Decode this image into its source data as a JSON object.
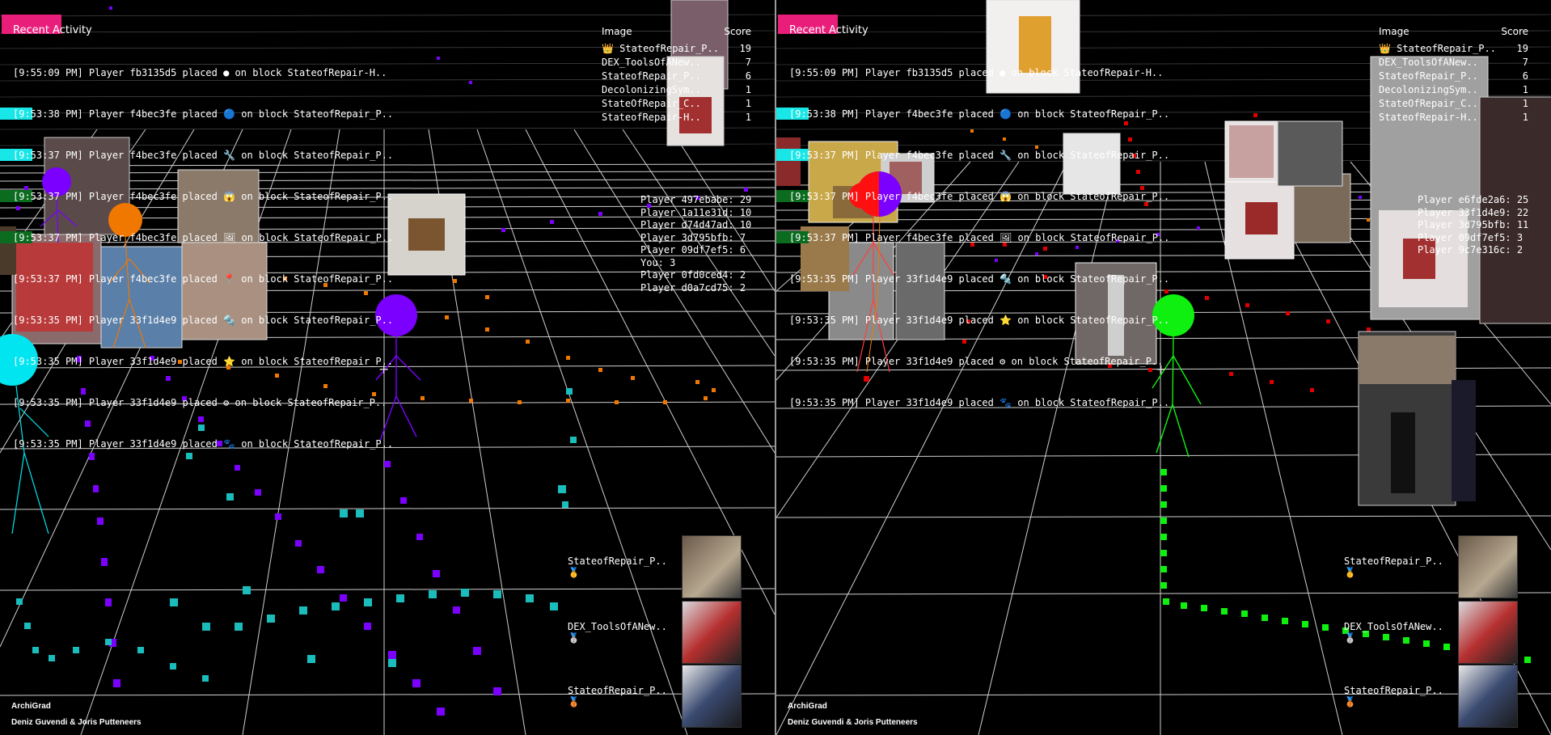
{
  "panes": [
    {
      "id": "left",
      "activity_title": "Recent Activity",
      "log": [
        {
          "text": "[9:55:09 PM] Player fb3135d5 placed ● on block StateofRepair-H..",
          "swatch": ""
        },
        {
          "text": "[9:53:38 PM] Player f4bec3fe placed 🔵 on block StateofRepair_P..",
          "swatch": "#19e6e6"
        },
        {
          "text": "[9:53:37 PM] Player f4bec3fe placed 🔧 on block StateofRepair_P..",
          "swatch": "#19e6e6"
        },
        {
          "text": "[9:53:37 PM] Player f4bec3fe placed 😱 on block StateofRepair_P..",
          "swatch": "#0b6b1f"
        },
        {
          "text": "[9:53:37 PM] Player f4bec3fe placed 🖼 on block StateofRepair_P..",
          "swatch": "#0b6b1f"
        },
        {
          "text": "[9:53:37 PM] Player f4bec3fe placed 📍 on block StateofRepair_P..",
          "swatch": ""
        },
        {
          "text": "[9:53:35 PM] Player 33f1d4e9 placed 🔩 on block StateofRepair_P..",
          "swatch": ""
        },
        {
          "text": "[9:53:35 PM] Player 33f1d4e9 placed ⭐ on block StateofRepair_P..",
          "swatch": ""
        },
        {
          "text": "[9:53:35 PM] Player 33f1d4e9 placed ⚙ on block StateofRepair_P..",
          "swatch": ""
        },
        {
          "text": "[9:53:35 PM] Player 33f1d4e9 placed 🐾 on block StateofRepair_P..",
          "swatch": ""
        }
      ],
      "score_header": {
        "image": "Image",
        "score": "Score"
      },
      "scores": [
        {
          "name": "👑 StateofRepair_P..",
          "score": "19"
        },
        {
          "name": "DEX_ToolsOfANew..",
          "score": "7"
        },
        {
          "name": "StateofRepair_P..",
          "score": "6"
        },
        {
          "name": "DecolonizingSym..",
          "score": "1"
        },
        {
          "name": "StateOfRepair_C..",
          "score": "1"
        },
        {
          "name": "StateofRepair-H..",
          "score": "1"
        }
      ],
      "players": [
        "Player 497ebabe: 29",
        "Player 1a11e31d: 10",
        "Player d74d47ad: 10",
        "Player 3d795bfb: 7",
        "Player 09df7ef5: 6",
        "You: 3",
        "Player 0fd0ced4: 2",
        "Player d0a7cd75: 2"
      ],
      "thumbs": [
        {
          "label": "StateofRepair_P.. 🥇"
        },
        {
          "label": "DEX_ToolsOfANew.. 🥈"
        },
        {
          "label": "StateofRepair_P.. 🥉"
        }
      ],
      "credit_title": "ArchiGrad",
      "credit_authors": "Deniz Guvendi & Joris Putteneers"
    },
    {
      "id": "right",
      "activity_title": "Recent Activity",
      "log": [
        {
          "text": "[9:55:09 PM] Player fb3135d5 placed ● on block StateofRepair-H..",
          "swatch": ""
        },
        {
          "text": "[9:53:38 PM] Player f4bec3fe placed 🔵 on block StateofRepair_P..",
          "swatch": "#19e6e6"
        },
        {
          "text": "[9:53:37 PM] Player f4bec3fe placed 🔧 on block StateofRepair_P..",
          "swatch": "#19e6e6"
        },
        {
          "text": "[9:53:37 PM] Player f4bec3fe placed 😱 on block StateofRepair_P..",
          "swatch": "#0b6b1f"
        },
        {
          "text": "[9:53:37 PM] Player f4bec3fe placed 🖼 on block StateofRepair_P..",
          "swatch": "#0b6b1f"
        },
        {
          "text": "[9:53:35 PM] Player 33f1d4e9 placed 🔩 on block StateofRepair_P..",
          "swatch": ""
        },
        {
          "text": "[9:53:35 PM] Player 33f1d4e9 placed ⭐ on block StateofRepair_P..",
          "swatch": ""
        },
        {
          "text": "[9:53:35 PM] Player 33f1d4e9 placed ⚙ on block StateofRepair_P..",
          "swatch": ""
        },
        {
          "text": "[9:53:35 PM] Player 33f1d4e9 placed 🐾 on block StateofRepair_P..",
          "swatch": ""
        }
      ],
      "score_header": {
        "image": "Image",
        "score": "Score"
      },
      "scores": [
        {
          "name": "👑 StateofRepair_P..",
          "score": "19"
        },
        {
          "name": "DEX_ToolsOfANew..",
          "score": "7"
        },
        {
          "name": "StateofRepair_P..",
          "score": "6"
        },
        {
          "name": "DecolonizingSym..",
          "score": "1"
        },
        {
          "name": "StateOfRepair_C..",
          "score": "1"
        },
        {
          "name": "StateofRepair-H..",
          "score": "1"
        }
      ],
      "players": [
        "Player e6fde2a6: 25",
        "Player 33f1d4e9: 22",
        "Player 3d795bfb: 11",
        "Player 09df7ef5: 3",
        "Player 9c7e316c: 2"
      ],
      "thumbs": [
        {
          "label": "StateofRepair_P.. 🥇"
        },
        {
          "label": "DEX_ToolsOfANew.. 🥈"
        },
        {
          "label": "StateofRepair_P.. 🥉"
        }
      ],
      "credit_title": "ArchiGrad",
      "credit_authors": "Deniz Guvendi & Joris Putteneers"
    }
  ],
  "colors": {
    "purple_player": "#7b00ff",
    "orange_player": "#f07800",
    "cyan_player": "#00e5f0",
    "red_player": "#ff1010",
    "green_player": "#10f010",
    "accent": "#e91e7b"
  }
}
